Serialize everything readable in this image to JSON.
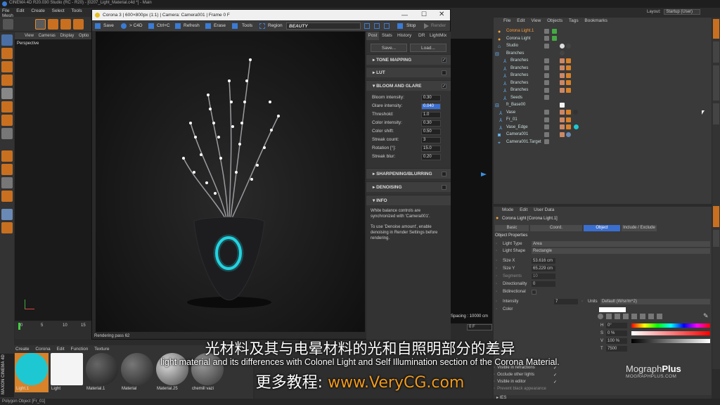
{
  "app": {
    "title": "CINEMA 4D R20.030 Studio (RC - R20) - [0207_Light_Material.c4d *] - Main",
    "menu": [
      "File",
      "Edit",
      "Create",
      "Select",
      "Tools",
      "Mesh"
    ],
    "layout_label": "Layout:",
    "layout_value": "Startup (User)"
  },
  "viewport": {
    "menu": [
      "View",
      "Cameras",
      "Display",
      "Optio"
    ],
    "label": "Perspective",
    "spacing": "Spacing : 10000 cm",
    "frame": "0 F"
  },
  "timeline": {
    "ticks": [
      "0",
      "5",
      "10",
      "15"
    ]
  },
  "vfb": {
    "title": "Corona 3 | 600×800px (1:1) | Camera: Camera001 | Frame 0 F",
    "toolbar": [
      "Save",
      "> C4D",
      "Ctrl+C",
      "Refresh",
      "Erase",
      "Tools",
      "Region"
    ],
    "pass": "BEAUTY",
    "stop": "Stop",
    "render": "Render",
    "status": "Rendering pass 62",
    "tabs": [
      "Post",
      "Stats",
      "History",
      "DR",
      "LightMix"
    ],
    "save_btn": "Save...",
    "load_btn": "Load...",
    "sections": {
      "tone_mapping": "TONE MAPPING",
      "lut": "LUT",
      "bloom": "BLOOM AND GLARE",
      "sharpen": "SHARPENING/BLURRING",
      "denoise": "DENOISING",
      "info": "INFO"
    },
    "bloom_params": [
      {
        "label": "Bloom intensity:",
        "value": "0.30"
      },
      {
        "label": "Glare intensity:",
        "value": "0.040"
      },
      {
        "label": "Threshold:",
        "value": "1.0"
      },
      {
        "label": "Color intensity:",
        "value": "0.30"
      },
      {
        "label": "Color shift:",
        "value": "0.50"
      },
      {
        "label": "Streak count:",
        "value": "3"
      },
      {
        "label": "Rotation [°]:",
        "value": "15.0"
      },
      {
        "label": "Streak blur:",
        "value": "0.20"
      }
    ],
    "info_text1": "White balance controls are synchronized with 'Camera001'.",
    "info_text2": "To use 'Denoise amount', enable denoising in Render Settings before rendering."
  },
  "object_manager": {
    "menu": [
      "File",
      "Edit",
      "View",
      "Objects",
      "Tags",
      "Bookmarks"
    ],
    "objects": [
      {
        "name": "Corona Light.1",
        "hl": true
      },
      {
        "name": "Corona Light",
        "hl": false
      },
      {
        "name": "Studio",
        "hl": false
      },
      {
        "name": "Branches",
        "hl": false
      },
      {
        "name": "Branches",
        "hl": false
      },
      {
        "name": "Branches",
        "hl": false
      },
      {
        "name": "Branches",
        "hl": false
      },
      {
        "name": "Branches",
        "hl": false
      },
      {
        "name": "Branches",
        "hl": false
      },
      {
        "name": "Seeds",
        "hl": false
      },
      {
        "name": "fr_Base00",
        "hl": false
      },
      {
        "name": "Vase",
        "hl": false
      },
      {
        "name": "Fr_01",
        "hl": false
      },
      {
        "name": "Vase_Edge",
        "hl": false
      },
      {
        "name": "Camera001",
        "hl": false
      },
      {
        "name": "Camera001.Target",
        "hl": false
      }
    ]
  },
  "attributes": {
    "menu": [
      "Mode",
      "Edit",
      "User Data"
    ],
    "object_label": "Corona Light [Corona Light.1]",
    "tabs": [
      "Basic",
      "Coord.",
      "Object",
      "Include / Exclude"
    ],
    "section": "Object Properties",
    "rows": [
      {
        "label": "Light Type",
        "value": "Area"
      },
      {
        "label": "Light Shape",
        "value": "Rectangle"
      },
      {
        "label": "Size X",
        "value": "53.616 cm"
      },
      {
        "label": "Size Y",
        "value": "65.229 cm"
      },
      {
        "label": "Segments",
        "value": "10"
      },
      {
        "label": "Directionality",
        "value": "0"
      },
      {
        "label": "Bidirectional",
        "value": ""
      },
      {
        "label": "Intensity",
        "value": "7"
      },
      {
        "label": "Color",
        "value": ""
      }
    ],
    "units_label": "Units",
    "units_value": "Default (W/sr/m^2)",
    "color_fields": [
      {
        "label": "H",
        "value": "0°"
      },
      {
        "label": "S",
        "value": "0 %"
      },
      {
        "label": "V",
        "value": "100 %"
      },
      {
        "label": "T",
        "value": "7500"
      }
    ],
    "bottom_rows": [
      "Visible in refractions",
      "Occlude other lights",
      "Visible in editor",
      "Prevent black appearance",
      "IES"
    ]
  },
  "materials": {
    "menu": [
      "Create",
      "Corona",
      "Edit",
      "Function",
      "Texture"
    ],
    "items": [
      {
        "name": "Light.1",
        "color": "#1ec8d2"
      },
      {
        "name": "Light",
        "color": "#f4f4f4"
      },
      {
        "name": "Material.1",
        "color": "#3a3a3a"
      },
      {
        "name": "Material",
        "color": "#4a4a4a"
      },
      {
        "name": "Material.25",
        "color": "#8a8a8a"
      },
      {
        "name": "chemill vazi",
        "color": "#6a6a6a"
      }
    ],
    "brand": "MAXON CINEMA 4D"
  },
  "statusbar": {
    "text": "Polygon Object [Fr_01]"
  },
  "overlay": {
    "chinese": "光材料及其与电晕材料的光和自照明部分的差异",
    "english": "light material and its differences with Colonel Light and Self Illumination section of the Corona Material.",
    "site_prefix": "更多教程:",
    "site": "www.VeryCG.com",
    "logo1": "Mograph",
    "logo2": "Plus",
    "logo_sub": "MOGRAPHPLUS.COM"
  }
}
